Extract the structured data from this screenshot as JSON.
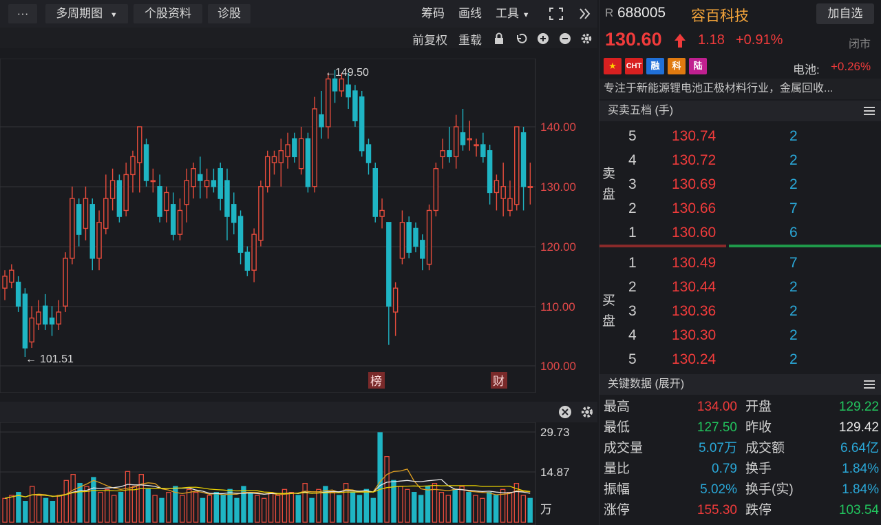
{
  "toolbar": {
    "more": "···",
    "period": "多周期图",
    "profile": "个股资料",
    "diagnose": "诊股",
    "chips": "筹码",
    "draw": "画线",
    "tools": "工具"
  },
  "subtoolbar": {
    "adjust": "前复权",
    "overlay": "重载"
  },
  "chart": {
    "y_labels": [
      "140.00",
      "130.00",
      "120.00",
      "110.00",
      "100.00"
    ],
    "high_marker": "149.50",
    "low_marker": "101.51",
    "tag_rank": "榜",
    "tag_finance": "财"
  },
  "volume": {
    "labels": [
      "29.73",
      "14.87",
      "万"
    ]
  },
  "stock": {
    "prefix": "R",
    "code": "688005",
    "name": "容百科技",
    "add_button": "加自选",
    "price": "130.60",
    "change": "1.18",
    "change_pct": "+0.91%",
    "status": "闭市",
    "sector_label": "电池:",
    "sector_change": "+0.26%",
    "tags": [
      "CN",
      "CHT",
      "融",
      "科",
      "陆"
    ],
    "description": "专注于新能源锂电池正极材料行业，金属回收..."
  },
  "orderbook": {
    "title": "买卖五档 (手)",
    "sell_label": "卖盘",
    "buy_label": "买盘",
    "sell": [
      {
        "level": "5",
        "price": "130.74",
        "volume": "2"
      },
      {
        "level": "4",
        "price": "130.72",
        "volume": "2"
      },
      {
        "level": "3",
        "price": "130.69",
        "volume": "2"
      },
      {
        "level": "2",
        "price": "130.66",
        "volume": "7"
      },
      {
        "level": "1",
        "price": "130.60",
        "volume": "6"
      }
    ],
    "buy": [
      {
        "level": "1",
        "price": "130.49",
        "volume": "7"
      },
      {
        "level": "2",
        "price": "130.44",
        "volume": "2"
      },
      {
        "level": "3",
        "price": "130.36",
        "volume": "2"
      },
      {
        "level": "4",
        "price": "130.30",
        "volume": "2"
      },
      {
        "level": "5",
        "price": "130.24",
        "volume": "2"
      }
    ]
  },
  "keydata": {
    "title": "关键数据 (展开)",
    "rows": [
      {
        "l1": "最高",
        "v1": "134.00",
        "l2": "开盘",
        "v2": "129.22"
      },
      {
        "l1": "最低",
        "v1": "127.50",
        "l2": "昨收",
        "v2": "129.42"
      },
      {
        "l1": "成交量",
        "v1": "5.07万",
        "l2": "成交额",
        "v2": "6.64亿"
      },
      {
        "l1": "量比",
        "v1": "0.79",
        "l2": "换手",
        "v2": "1.84%"
      },
      {
        "l1": "振幅",
        "v1": "5.02%",
        "l2": "换手(实)",
        "v2": "1.84%"
      },
      {
        "l1": "涨停",
        "v1": "155.30",
        "l2": "跌停",
        "v2": "103.54"
      }
    ]
  },
  "colors": {
    "up": "#e74c3c",
    "down": "#1fb5c4",
    "ma1": "#e0a020",
    "ma2": "#e8e8e8",
    "ma3": "#e8d000"
  }
}
